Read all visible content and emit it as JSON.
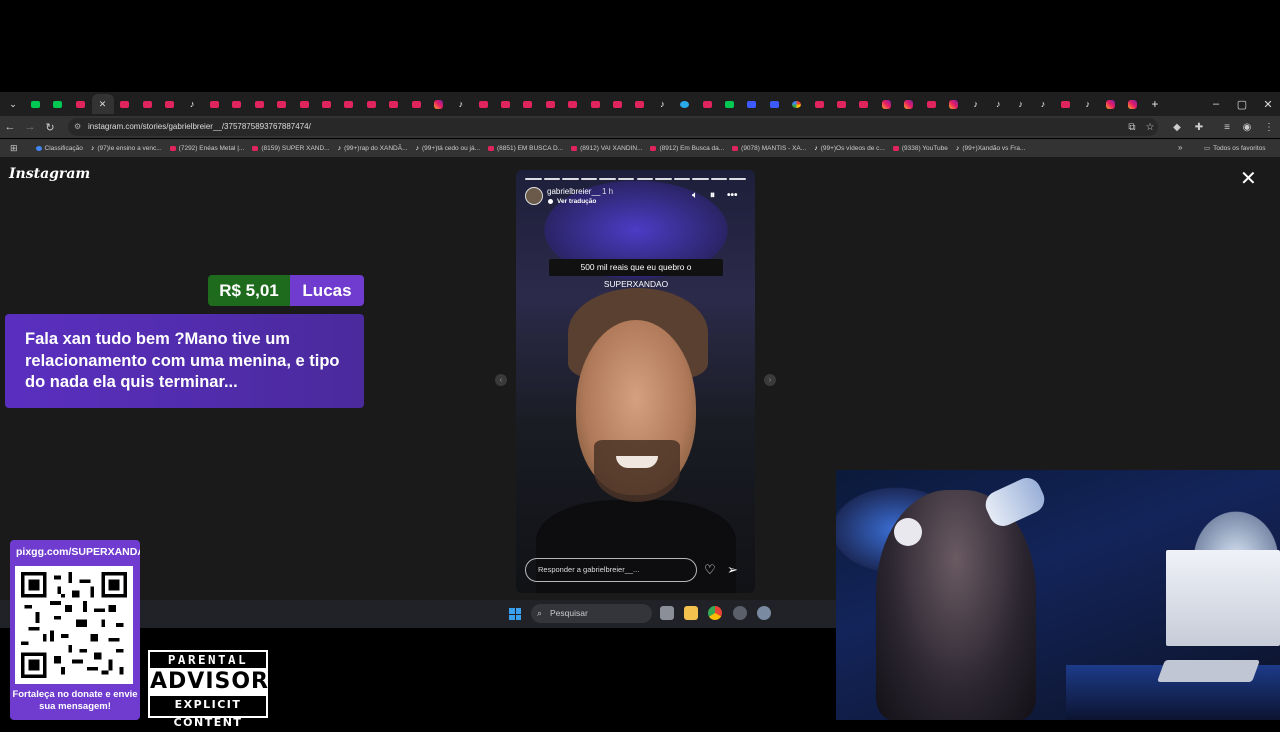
{
  "browser": {
    "tabs": [
      "grid",
      "g",
      "g",
      "yt",
      "close",
      "yt",
      "yt",
      "yt",
      "tt",
      "yt",
      "yt",
      "yt",
      "yt",
      "yt",
      "yt",
      "yt",
      "yt",
      "yt",
      "yt",
      "ig",
      "tt",
      "yt",
      "yt",
      "yt",
      "yt",
      "yt",
      "yt",
      "yt",
      "yt",
      "tt",
      "tg",
      "yt",
      "kick",
      "bl",
      "bl",
      "go",
      "yt",
      "yt",
      "yt",
      "ig",
      "ig",
      "yt",
      "ig",
      "tt",
      "tt",
      "tt",
      "tt",
      "yt",
      "tt",
      "ig",
      "ig"
    ],
    "new_tab": "+",
    "window_controls": [
      "–",
      "▢",
      "✕"
    ],
    "url": "instagram.com/stories/gabrielbreier__/3757875893767887474/",
    "bookmarks": [
      {
        "icon": "cl",
        "label": "Classificação"
      },
      {
        "icon": "tt",
        "label": "(97)Ie ensino a venc..."
      },
      {
        "icon": "yt",
        "label": "(7292) Enéas Metal |..."
      },
      {
        "icon": "yt",
        "label": "(8159) SUPER XAND..."
      },
      {
        "icon": "tt",
        "label": "(99+)rap do XANDÃ..."
      },
      {
        "icon": "tt",
        "label": "(99+)tá cedo ou já..."
      },
      {
        "icon": "yt",
        "label": "(8851) EM BUSCA D..."
      },
      {
        "icon": "yt",
        "label": "(8912) VAI XANDIN..."
      },
      {
        "icon": "yt",
        "label": "(8912) Em Busca da..."
      },
      {
        "icon": "yt",
        "label": "(9078) MANTIS - XA..."
      },
      {
        "icon": "tt",
        "label": "(99+)Os vídeos de c..."
      },
      {
        "icon": "yt",
        "label": "(9338) YouTube"
      },
      {
        "icon": "tt",
        "label": "(99+)Xandão vs Fra..."
      }
    ],
    "all_bookmarks": "Todos os favoritos"
  },
  "instagram": {
    "logo": "Instagram",
    "story": {
      "username": "gabrielbreier__",
      "time": "1 h",
      "translate": "Ver tradução",
      "caption": "500 mil reais que eu quebro o SUPERXANDAO",
      "reply_placeholder": "Responder a gabrielbreier__..."
    }
  },
  "donation": {
    "amount": "R$ 5,01",
    "name": "Lucas",
    "message": "Fala xan tudo bem ?Mano tive um relacionamento com uma menina, e tipo do nada ela quis terminar..."
  },
  "taskbar": {
    "search": "Pesquisar"
  },
  "pix": {
    "url": "pixgg.com/SUPERXANDA",
    "caption": "Fortaleça no donate e envie sua mensagem!"
  },
  "advisory": {
    "top": "PARENTAL",
    "mid": "ADVISORY",
    "bottom": "EXPLICIT CONTENT"
  },
  "colors": {
    "donation_green": "#1e6b1e",
    "donation_purple": "#6f3ccf",
    "browser_bg": "#1f1f1f"
  }
}
